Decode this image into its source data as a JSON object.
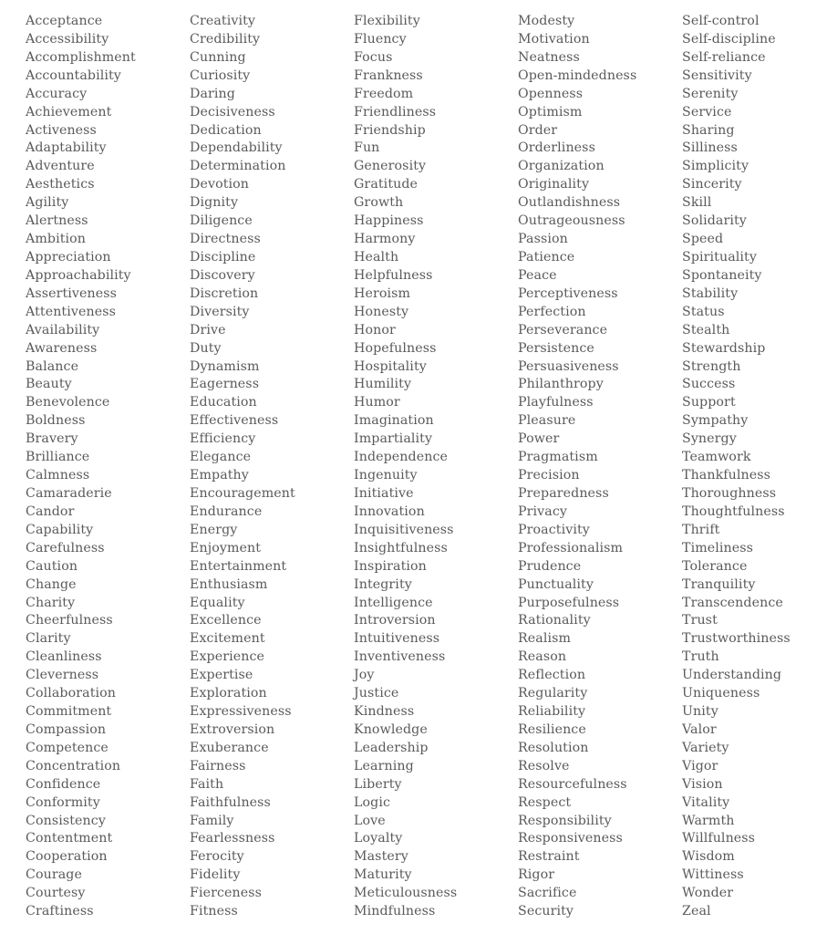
{
  "columns": [
    [
      "Acceptance",
      "Accessibility",
      "Accomplishment",
      "Accountability",
      "Accuracy",
      "Achievement",
      "Activeness",
      "Adaptability",
      "Adventure",
      "Aesthetics",
      "Agility",
      "Alertness",
      "Ambition",
      "Appreciation",
      "Approachability",
      "Assertiveness",
      "Attentiveness",
      "Availability",
      "Awareness",
      "Balance",
      "Beauty",
      "Benevolence",
      "Boldness",
      "Bravery",
      "Brilliance",
      "Calmness",
      "Camaraderie",
      "Candor",
      "Capability",
      "Carefulness",
      "Caution",
      "Change",
      "Charity",
      "Cheerfulness",
      "Clarity",
      "Cleanliness",
      "Cleverness",
      "Collaboration",
      "Commitment",
      "Compassion",
      "Competence",
      "Concentration",
      "Confidence",
      "Conformity",
      "Consistency",
      "Contentment",
      "Cooperation",
      "Courage",
      "Courtesy",
      "Craftiness"
    ],
    [
      "Creativity",
      "Credibility",
      "Cunning",
      "Curiosity",
      "Daring",
      "Decisiveness",
      "Dedication",
      "Dependability",
      "Determination",
      "Devotion",
      "Dignity",
      "Diligence",
      "Directness",
      "Discipline",
      "Discovery",
      "Discretion",
      "Diversity",
      "Drive",
      "Duty",
      "Dynamism",
      "Eagerness",
      "Education",
      "Effectiveness",
      "Efficiency",
      "Elegance",
      "Empathy",
      "Encouragement",
      "Endurance",
      "Energy",
      "Enjoyment",
      "Entertainment",
      "Enthusiasm",
      "Equality",
      "Excellence",
      "Excitement",
      "Experience",
      "Expertise",
      "Exploration",
      "Expressiveness",
      "Extroversion",
      "Exuberance",
      "Fairness",
      "Faith",
      "Faithfulness",
      "Family",
      "Fearlessness",
      "Ferocity",
      "Fidelity",
      "Fierceness",
      "Fitness"
    ],
    [
      "Flexibility",
      "Fluency",
      "Focus",
      "Frankness",
      "Freedom",
      "Friendliness",
      "Friendship",
      "Fun",
      "Generosity",
      "Gratitude",
      "Growth",
      "Happiness",
      "Harmony",
      "Health",
      "Helpfulness",
      "Heroism",
      "Honesty",
      "Honor",
      "Hopefulness",
      "Hospitality",
      "Humility",
      "Humor",
      "Imagination",
      "Impartiality",
      "Independence",
      "Ingenuity",
      "Initiative",
      "Innovation",
      "Inquisitiveness",
      "Insightfulness",
      "Inspiration",
      "Integrity",
      "Intelligence",
      "Introversion",
      "Intuitiveness",
      "Inventiveness",
      "Joy",
      "Justice",
      "Kindness",
      "Knowledge",
      "Leadership",
      "Learning",
      "Liberty",
      "Logic",
      "Love",
      "Loyalty",
      "Mastery",
      "Maturity",
      "Meticulousness",
      "Mindfulness"
    ],
    [
      "Modesty",
      "Motivation",
      "Neatness",
      "Open-mindedness",
      "Openness",
      "Optimism",
      "Order",
      "Orderliness",
      "Organization",
      "Originality",
      "Outlandishness",
      "Outrageousness",
      "Passion",
      "Patience",
      "Peace",
      "Perceptiveness",
      "Perfection",
      "Perseverance",
      "Persistence",
      "Persuasiveness",
      "Philanthropy",
      "Playfulness",
      "Pleasure",
      "Power",
      "Pragmatism",
      "Precision",
      "Preparedness",
      "Privacy",
      "Proactivity",
      "Professionalism",
      "Prudence",
      "Punctuality",
      "Purposefulness",
      "Rationality",
      "Realism",
      "Reason",
      "Reflection",
      "Regularity",
      "Reliability",
      "Resilience",
      "Resolution",
      "Resolve",
      "Resourcefulness",
      "Respect",
      "Responsibility",
      "Responsiveness",
      "Restraint",
      "Rigor",
      "Sacrifice",
      "Security"
    ],
    [
      "Self-control",
      "Self-discipline",
      "Self-reliance",
      "Sensitivity",
      "Serenity",
      "Service",
      "Sharing",
      "Silliness",
      "Simplicity",
      "Sincerity",
      "Skill",
      "Solidarity",
      "Speed",
      "Spirituality",
      "Spontaneity",
      "Stability",
      "Status",
      "Stealth",
      "Stewardship",
      "Strength",
      "Success",
      "Support",
      "Sympathy",
      "Synergy",
      "Teamwork",
      "Thankfulness",
      "Thoroughness",
      "Thoughtfulness",
      "Thrift",
      "Timeliness",
      "Tolerance",
      "Tranquility",
      "Transcendence",
      "Trust",
      "Trustworthiness",
      "Truth",
      "Understanding",
      "Uniqueness",
      "Unity",
      "Valor",
      "Variety",
      "Vigor",
      "Vision",
      "Vitality",
      "Warmth",
      "Willfulness",
      "Wisdom",
      "Wittiness",
      "Wonder",
      "Zeal"
    ]
  ],
  "colors": {
    "text": "#5a5a5a",
    "background": "#ffffff"
  }
}
